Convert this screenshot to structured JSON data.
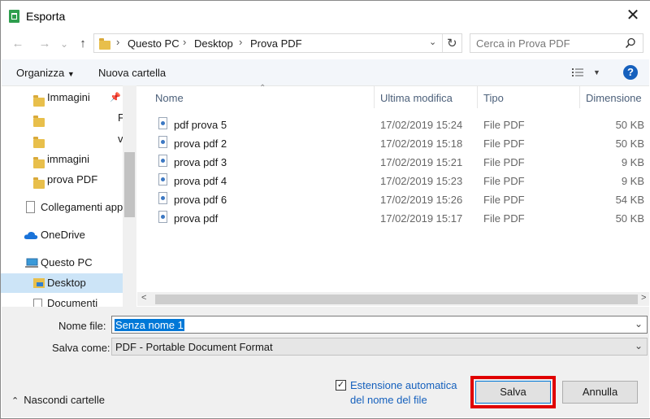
{
  "window": {
    "title": "Esporta"
  },
  "nav": {
    "back_glyph": "←",
    "forward_glyph": "→",
    "dropdown_glyph": "⌄",
    "up_glyph": "↑",
    "breadcrumb": [
      "Questo PC",
      "Desktop",
      "Prova PDF"
    ],
    "separator": "›",
    "refresh_glyph": "↻",
    "search_placeholder": "Cerca in Prova PDF"
  },
  "toolbar": {
    "organize_label": "Organizza",
    "new_folder_label": "Nuova cartella",
    "help_label": "?"
  },
  "sidebar": {
    "items": [
      {
        "label": "Immagini",
        "icon": "folder-icon"
      },
      {
        "label": "F",
        "icon": "folder-icon"
      },
      {
        "label": "v",
        "icon": "folder-icon"
      },
      {
        "label": "immagini",
        "icon": "folder-icon"
      },
      {
        "label": "prova PDF",
        "icon": "folder-icon"
      },
      {
        "label": "Collegamenti app",
        "icon": "document-icon"
      },
      {
        "label": "OneDrive",
        "icon": "cloud-icon"
      },
      {
        "label": "Questo PC",
        "icon": "computer-icon"
      },
      {
        "label": "Desktop",
        "icon": "desktop-folder-icon"
      },
      {
        "label": "Documenti",
        "icon": "document-icon"
      }
    ]
  },
  "filelist": {
    "columns": {
      "name": "Nome",
      "modified": "Ultima modifica",
      "type": "Tipo",
      "size": "Dimensione"
    },
    "rows": [
      {
        "name": "pdf prova 5",
        "modified": "17/02/2019 15:24",
        "type": "File PDF",
        "size": "50 KB"
      },
      {
        "name": "prova pdf 2",
        "modified": "17/02/2019 15:18",
        "type": "File PDF",
        "size": "50 KB"
      },
      {
        "name": "prova pdf 3",
        "modified": "17/02/2019 15:21",
        "type": "File PDF",
        "size": "9 KB"
      },
      {
        "name": "prova pdf 4",
        "modified": "17/02/2019 15:23",
        "type": "File PDF",
        "size": "9 KB"
      },
      {
        "name": "prova pdf 6",
        "modified": "17/02/2019 15:26",
        "type": "File PDF",
        "size": "54 KB"
      },
      {
        "name": "prova pdf",
        "modified": "17/02/2019 15:17",
        "type": "File PDF",
        "size": "50 KB"
      }
    ]
  },
  "form": {
    "filename_label": "Nome file:",
    "filename_value": "Senza nome 1",
    "savetype_label": "Salva come:",
    "savetype_value": "PDF - Portable Document Format",
    "auto_ext_line1": "Estensione automatica",
    "auto_ext_line2": "del nome del file",
    "auto_ext_checked": true,
    "hide_folders_label": "Nascondi cartelle",
    "save_label": "Salva",
    "cancel_label": "Annulla"
  },
  "colors": {
    "accent": "#0078d7",
    "highlight_frame": "#e00000",
    "selection": "#cce4f7",
    "link": "#1560bd"
  }
}
